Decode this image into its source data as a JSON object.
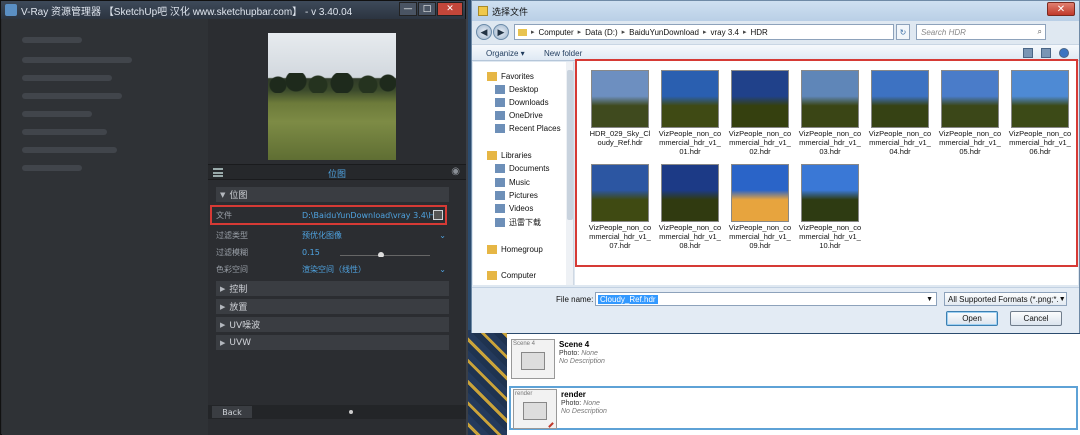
{
  "vray": {
    "title": "V-Ray 资源管理器 【SketchUp吧 汉化 www.sketchupbar.com】 - v 3.40.04",
    "window_buttons": [
      "—",
      "□",
      "✕"
    ],
    "asset_name": "位图",
    "sections": {
      "bitmap": "位图",
      "control": "控制",
      "placement": "放置",
      "uv_noise": "UV噪波",
      "uvw": "UVW"
    },
    "props": {
      "file_label": "文件",
      "file_value": "D:\\BaiduYunDownload\\vray 3.4\\HD...",
      "filter_type_label": "过滤类型",
      "filter_type_value": "预优化图像",
      "filter_blur_label": "过滤模糊",
      "filter_blur_value": "0.15",
      "color_space_label": "色彩空间",
      "color_space_value": "渲染空间（线性）"
    },
    "back_label": "Back"
  },
  "dialog": {
    "title": "选择文件",
    "close": "✕",
    "breadcrumbs": [
      "Computer",
      "Data (D:)",
      "BaiduYunDownload",
      "vray 3.4",
      "HDR"
    ],
    "search_placeholder": "Search HDR",
    "toolbar": {
      "organize": "Organize ▾",
      "new_folder": "New folder"
    },
    "nav": {
      "favorites": "Favorites",
      "desktop": "Desktop",
      "downloads": "Downloads",
      "onedrive": "OneDrive",
      "recent": "Recent Places",
      "libraries": "Libraries",
      "documents": "Documents",
      "music": "Music",
      "pictures": "Pictures",
      "videos": "Videos",
      "xunlei": "迅雷下载",
      "homegroup": "Homegroup",
      "computer": "Computer"
    },
    "files": [
      {
        "name": "HDR_029_Sky_Cloudy_Ref.hdr",
        "top": "#6d8fc0",
        "bottom": "#3f4a1e"
      },
      {
        "name": "VizPeople_non_commercial_hdr_v1_01.hdr",
        "top": "#2a5fb0",
        "bottom": "#3f4a14"
      },
      {
        "name": "VizPeople_non_commercial_hdr_v1_02.hdr",
        "top": "#20418a",
        "bottom": "#35400f"
      },
      {
        "name": "VizPeople_non_commercial_hdr_v1_03.hdr",
        "top": "#5f86b8",
        "bottom": "#3a4515"
      },
      {
        "name": "VizPeople_non_commercial_hdr_v1_04.hdr",
        "top": "#3d72c2",
        "bottom": "#364214"
      },
      {
        "name": "VizPeople_non_commercial_hdr_v1_05.hdr",
        "top": "#4a7cc9",
        "bottom": "#3b4718"
      },
      {
        "name": "VizPeople_non_commercial_hdr_v1_06.hdr",
        "top": "#4e8ad4",
        "bottom": "#3c4a17"
      },
      {
        "name": "VizPeople_non_commercial_hdr_v1_07.hdr",
        "top": "#2c56a2",
        "bottom": "#3f4a12"
      },
      {
        "name": "VizPeople_non_commercial_hdr_v1_08.hdr",
        "top": "#1c3a86",
        "bottom": "#303a10"
      },
      {
        "name": "VizPeople_non_commercial_hdr_v1_09.hdr",
        "top": "#2a64c8",
        "bottom": "#e7a43e"
      },
      {
        "name": "VizPeople_non_commercial_hdr_v1_10.hdr",
        "top": "#3a78d6",
        "bottom": "#2e3b12"
      }
    ],
    "file_name_label": "File name:",
    "file_name_value": "Cloudy_Ref.hdr",
    "format_value": "All Supported Formats (*.png;*.",
    "open_label": "Open",
    "cancel_label": "Cancel"
  },
  "scenes": [
    {
      "thumb_label": "Scene 4",
      "name": "Scene 4",
      "photo_label": "Photo:",
      "photo_value": "None",
      "description": "No Description"
    },
    {
      "thumb_label": "render",
      "name": "render",
      "photo_label": "Photo:",
      "photo_value": "None",
      "description": "No Description"
    }
  ]
}
